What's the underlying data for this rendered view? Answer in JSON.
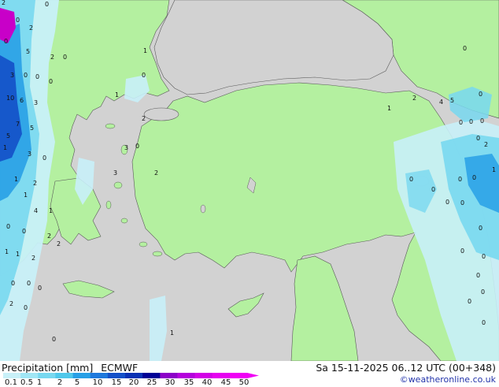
{
  "legend": {
    "title": "Precipitation [mm]",
    "model": "ECMWF",
    "date": "Sa 15-11-2025 06..12 UTC (00+348)",
    "credit": "©weatheronline.co.uk",
    "ticks": [
      "0.1",
      "0.5",
      "1",
      "2",
      "5",
      "10",
      "15",
      "20",
      "25",
      "30",
      "35",
      "40",
      "45",
      "50"
    ],
    "colors": [
      "#c8f0f8",
      "#a0e6f5",
      "#78d8f0",
      "#50c8eb",
      "#28a0e6",
      "#1e78dc",
      "#1450c8",
      "#0a32b4",
      "#000096",
      "#8c00c8",
      "#b400dc",
      "#d200e6",
      "#e600f0",
      "#f000f5"
    ]
  },
  "map_values": [
    "2",
    "0",
    "2",
    "0",
    "0",
    "5",
    "2",
    "0",
    "3",
    "0",
    "0",
    "0",
    "10",
    "6",
    "3",
    "7",
    "5",
    "5",
    "1",
    "3",
    "0",
    "1",
    "2",
    "1",
    "4",
    "1",
    "0",
    "0",
    "2",
    "2",
    "1",
    "1",
    "2",
    "0",
    "0",
    "0",
    "0",
    "2",
    "0",
    "1",
    "0",
    "1",
    "2",
    "3",
    "0",
    "3",
    "2",
    "1",
    "1",
    "2",
    "4",
    "5",
    "0",
    "0",
    "0",
    "0",
    "0",
    "0",
    "2",
    "0",
    "0",
    "0",
    "1",
    "0",
    "0",
    "0",
    "0",
    "0",
    "0",
    "0",
    "0",
    "0",
    "0"
  ],
  "colors": {
    "land": "#b4f0a0",
    "sea": "#d2d2d2",
    "coast": "#5a5a5a",
    "rain_light": "#c8f0f8",
    "rain_mid": "#78d8f0",
    "rain_heavy": "#1e78dc",
    "rain_extreme": "#c800c8"
  }
}
